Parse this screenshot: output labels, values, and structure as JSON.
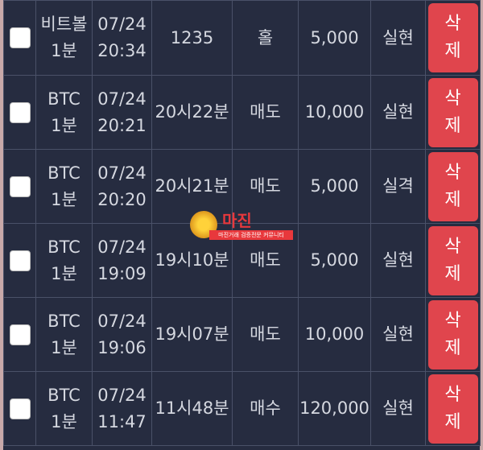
{
  "rows": [
    {
      "game_line1": "비트볼",
      "game_line2": "1분",
      "date": "07/24",
      "time": "20:34",
      "round": "1235",
      "pick": "홀",
      "amount": "5,000",
      "result": "실현",
      "delete_line1": "삭",
      "delete_line2": "제"
    },
    {
      "game_line1": "BTC",
      "game_line2": "1분",
      "date": "07/24",
      "time": "20:21",
      "round": "20시22분",
      "pick": "매도",
      "amount": "10,000",
      "result": "실현",
      "delete_line1": "삭",
      "delete_line2": "제"
    },
    {
      "game_line1": "BTC",
      "game_line2": "1분",
      "date": "07/24",
      "time": "20:20",
      "round": "20시21분",
      "pick": "매도",
      "amount": "5,000",
      "result": "실격",
      "delete_line1": "삭",
      "delete_line2": "제"
    },
    {
      "game_line1": "BTC",
      "game_line2": "1분",
      "date": "07/24",
      "time": "19:09",
      "round": "19시10분",
      "pick": "매도",
      "amount": "5,000",
      "result": "실현",
      "delete_line1": "삭",
      "delete_line2": "제"
    },
    {
      "game_line1": "BTC",
      "game_line2": "1분",
      "date": "07/24",
      "time": "19:06",
      "round": "19시07분",
      "pick": "매도",
      "amount": "10,000",
      "result": "실현",
      "delete_line1": "삭",
      "delete_line2": "제"
    },
    {
      "game_line1": "BTC",
      "game_line2": "1분",
      "date": "07/24",
      "time": "11:47",
      "round": "11시48분",
      "pick": "매수",
      "amount": "120,000",
      "result": "실현",
      "delete_line1": "삭",
      "delete_line2": "제"
    }
  ],
  "watermark": {
    "title": "마진",
    "subtitle": "마진거래 검증전문 커뮤니티"
  },
  "colors": {
    "background": "#262c40",
    "success": "#46a34e",
    "fail": "#d8282f",
    "delete_button": "#e0454d"
  }
}
